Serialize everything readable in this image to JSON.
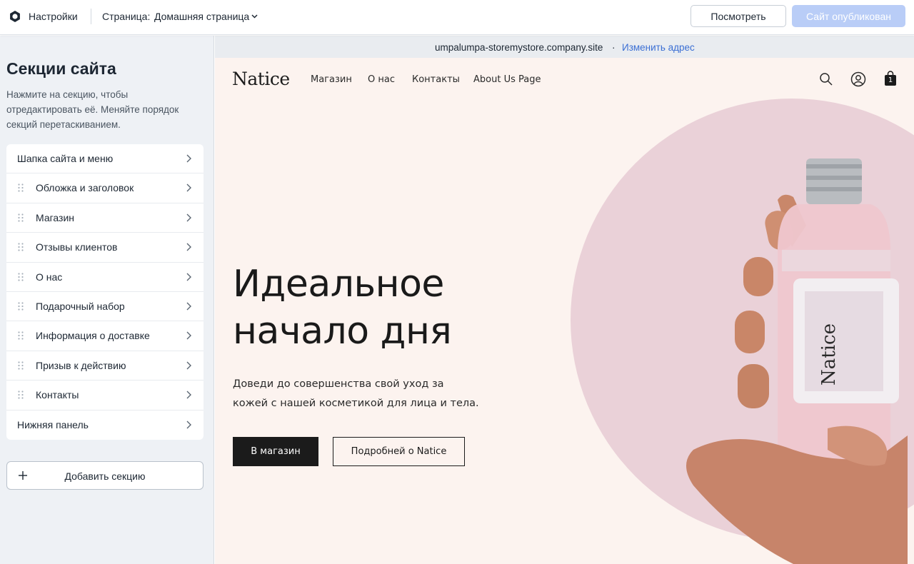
{
  "topbar": {
    "settings_label": "Настройки",
    "page_label": "Страница:",
    "page_value": "Домашняя страница",
    "preview_button": "Посмотреть",
    "published_button": "Сайт опубликован"
  },
  "sidebar": {
    "title": "Секции сайта",
    "description": "Нажмите на секцию, чтобы отредактировать её. Меняйте порядок секций перетаскиванием.",
    "items": [
      {
        "label": "Шапка сайта и меню",
        "draggable": false
      },
      {
        "label": "Обложка и заголовок",
        "draggable": true
      },
      {
        "label": "Магазин",
        "draggable": true
      },
      {
        "label": "Отзывы клиентов",
        "draggable": true
      },
      {
        "label": "О нас",
        "draggable": true
      },
      {
        "label": "Подарочный набор",
        "draggable": true
      },
      {
        "label": "Информация о доставке",
        "draggable": true
      },
      {
        "label": "Призыв к действию",
        "draggable": true
      },
      {
        "label": "Контакты",
        "draggable": true
      },
      {
        "label": "Нижняя панель",
        "draggable": false
      }
    ],
    "add_button": "Добавить секцию"
  },
  "url_bar": {
    "url": "umpalumpa-storemystore.company.site",
    "separator": "·",
    "change_link": "Изменить адрес"
  },
  "site": {
    "logo": "Natice",
    "nav": [
      "Магазин",
      "О нас",
      "Контакты",
      "About Us Page"
    ],
    "cart_count": "1",
    "hero_title_line1": "Идеальное",
    "hero_title_line2": "начало дня",
    "hero_text_line1": "Доведи до совершенства свой уход за",
    "hero_text_line2": "кожей с нашей косметикой для лица и тела.",
    "shop_button": "В магазин",
    "more_button": "Подробней о Natice",
    "bottle_label": "Natice"
  },
  "colors": {
    "accent_blue": "#3b6fd4",
    "published_button_bg": "#b9cdf7",
    "hero_bg": "#fcf3ef",
    "circle": "#ead1d8",
    "dark": "#1b1b1b"
  },
  "icons": [
    "settings-gear-icon",
    "chevron-down-icon",
    "drag-handle-icon",
    "chevron-right-icon",
    "plus-icon",
    "search-icon",
    "user-icon",
    "cart-icon"
  ]
}
